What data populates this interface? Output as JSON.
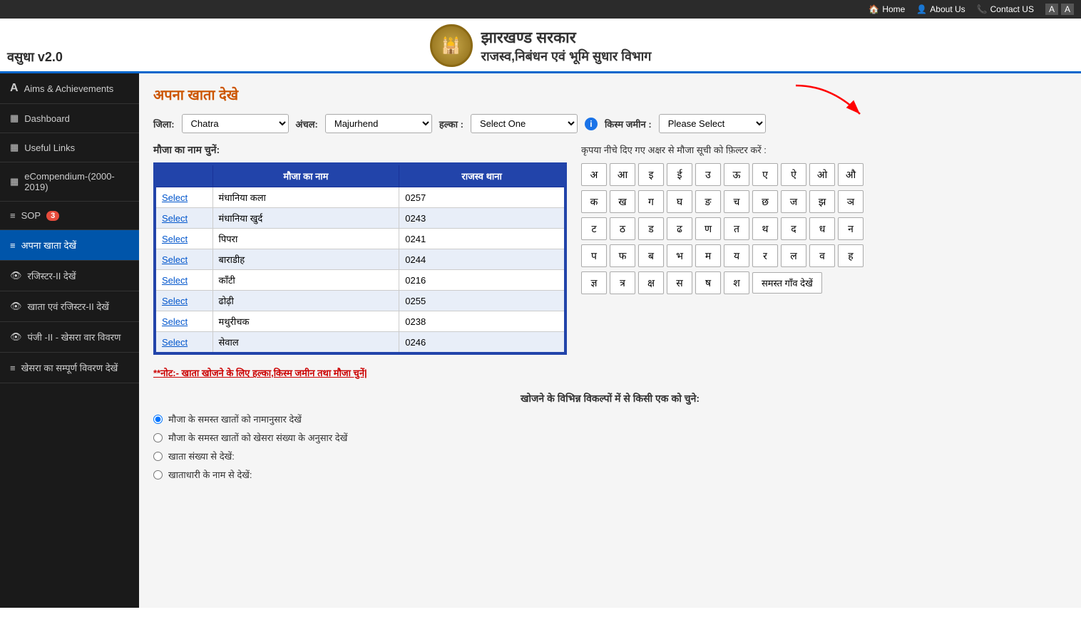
{
  "topbar": {
    "home_label": "Home",
    "about_label": "About Us",
    "contact_label": "Contact US"
  },
  "header": {
    "logo_symbol": "🏛",
    "title_hindi": "झारखण्ड सरकार",
    "subtitle_hindi": "राजस्व,निबंधन एवं भूमि सुधार विभाग",
    "vasudha_label": "वसुधा v2.0"
  },
  "sidebar": {
    "items": [
      {
        "id": "aims",
        "label": "Aims & Achievements",
        "icon": "A"
      },
      {
        "id": "dashboard",
        "label": "Dashboard",
        "icon": "▦"
      },
      {
        "id": "useful-links",
        "label": "Useful Links",
        "icon": "▦"
      },
      {
        "id": "ecompendium",
        "label": "eCompendium-(2000-2019)",
        "icon": "▦"
      },
      {
        "id": "sop",
        "label": "SOP",
        "icon": "≡",
        "badge": "3"
      },
      {
        "id": "apna-khata",
        "label": "अपना खाता देखें",
        "icon": "≡",
        "active": true
      },
      {
        "id": "register2",
        "label": "रजिस्टर-II देखें",
        "icon": "👁"
      },
      {
        "id": "khata-register2",
        "label": "खाता एवं रजिस्टर-II देखें",
        "icon": "👁"
      },
      {
        "id": "panji2",
        "label": "पंजी -II - खेसरा वार विवरण",
        "icon": "👁"
      },
      {
        "id": "khesra",
        "label": "खेसरा का सम्पूर्ण विवरण देखें",
        "icon": "≡"
      }
    ]
  },
  "main": {
    "page_title": "अपना खाता देखे",
    "filter": {
      "jila_label": "जिला:",
      "jila_value": "Chatra",
      "anchal_label": "अंचल:",
      "anchal_value": "Majurhend",
      "halka_label": "हल्का :",
      "halka_value": "Select One",
      "kism_label": "किस्म जमीन :",
      "kism_value": "Please Select"
    },
    "mauza_heading": "मौजा का नाम चुनें:",
    "table": {
      "col1": "मौजा का नाम",
      "col2": "राजस्व थाना",
      "rows": [
        {
          "select": "Select",
          "name": "मंधानिया कला",
          "thana": "0257"
        },
        {
          "select": "Select",
          "name": "मंधानिया खुर्द",
          "thana": "0243"
        },
        {
          "select": "Select",
          "name": "पिपरा",
          "thana": "0241"
        },
        {
          "select": "Select",
          "name": "बाराडीह",
          "thana": "0244"
        },
        {
          "select": "Select",
          "name": "काँटी",
          "thana": "0216"
        },
        {
          "select": "Select",
          "name": "ढोढ़ी",
          "thana": "0255"
        },
        {
          "select": "Select",
          "name": "मथुरीचक",
          "thana": "0238"
        },
        {
          "select": "Select",
          "name": "सेवाल",
          "thana": "0246"
        }
      ]
    },
    "alpha_heading": "कृपया नीचे दिए गए अक्षर से मौजा सूची को फ़िल्टर करें :",
    "alpha_rows": [
      [
        "अ",
        "आ",
        "इ",
        "ई",
        "उ",
        "ऊ",
        "ए",
        "ऐ",
        "ओ",
        "औ"
      ],
      [
        "क",
        "ख",
        "ग",
        "घ",
        "ङ",
        "च",
        "छ",
        "ज",
        "झ",
        "ञ"
      ],
      [
        "ट",
        "ठ",
        "ड",
        "ढ",
        "ण",
        "त",
        "थ",
        "द",
        "ध",
        "न"
      ],
      [
        "प",
        "फ",
        "ब",
        "भ",
        "म",
        "य",
        "र",
        "ल",
        "व",
        "ह"
      ],
      [
        "श",
        "ष",
        "स",
        "क्ष",
        "त्र",
        "ज्ञ"
      ]
    ],
    "samast_btn": "समस्त गाँव देखें",
    "note": "**नोट:- खाता खोजने के लिए हल्का,किस्म जमीन तथा मौजा चुनें|",
    "search_heading": "खोजने के विभिन्न विकल्पों में से किसी एक को चुने:",
    "search_options": [
      {
        "id": "opt1",
        "label": "मौजा के समस्त खातों को नामानुसार देखें",
        "checked": true
      },
      {
        "id": "opt2",
        "label": "मौजा के समस्त खातों को खेसरा संख्या के अनुसार देखें",
        "checked": false
      },
      {
        "id": "opt3",
        "label": "खाता संख्या से देखें:",
        "checked": false
      },
      {
        "id": "opt4",
        "label": "खाताधारी के नाम से देखें:",
        "checked": false
      }
    ]
  }
}
